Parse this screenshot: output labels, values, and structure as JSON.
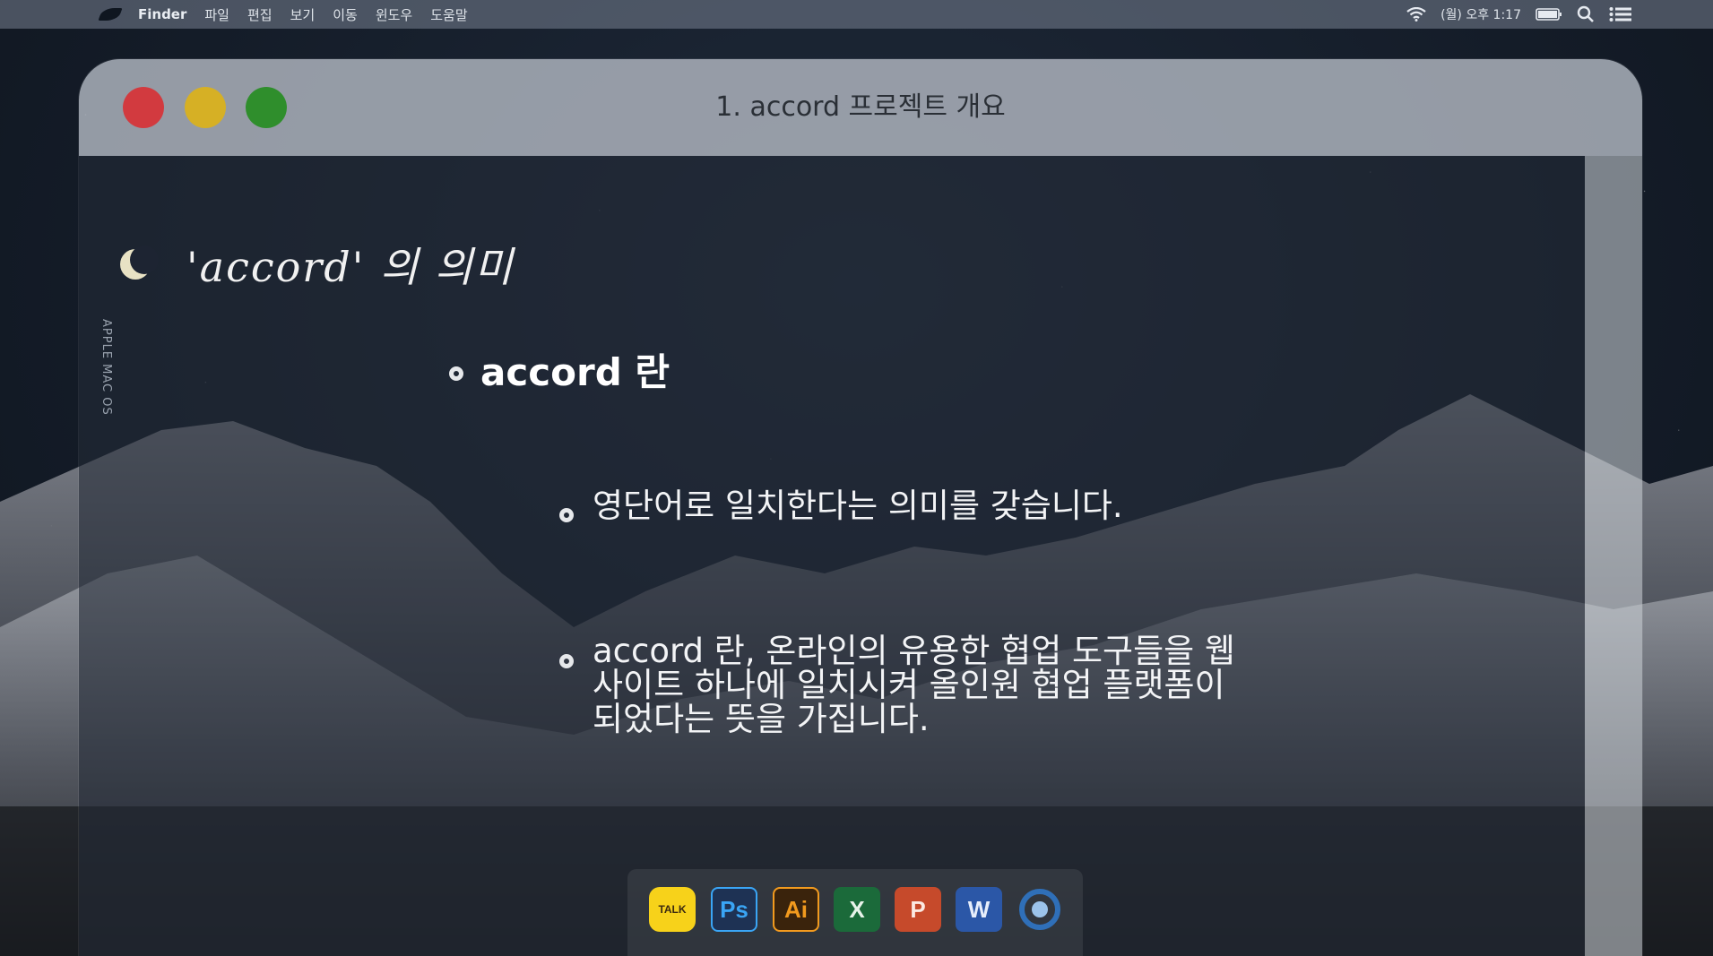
{
  "menubar": {
    "app_name": "Finder",
    "menus": [
      "파일",
      "편집",
      "보기",
      "이동",
      "윈도우",
      "도움말"
    ],
    "clock": "(월) 오후 1:17"
  },
  "window": {
    "title": "1. accord 프로젝트 개요"
  },
  "slide": {
    "section_title": "'accord' 의 의미",
    "side_label": "APPLE MAC OS",
    "heading": "accord 란",
    "paragraph_1": "영단어로 일치한다는 의미를 갖습니다.",
    "paragraph_2_line_1": "accord 란, 온라인의 유용한 협업 도구들을 웹",
    "paragraph_2_line_2": "사이트 하나에 일치시켜 올인원 협업 플랫폼이",
    "paragraph_2_line_3": "되었다는 뜻을 가집니다."
  },
  "dock": {
    "talk": "TALK",
    "ps": "Ps",
    "ai": "Ai",
    "excel": "X",
    "powerpoint": "P",
    "word": "W"
  },
  "colors": {
    "close": "#d23a3f",
    "minimize": "#d6b025",
    "maximize": "#2f8e2c"
  },
  "icons": [
    "app-logo-icon",
    "wifi-icon",
    "battery-icon",
    "search-icon",
    "list-icon",
    "moon-icon",
    "kakaotalk-icon",
    "photoshop-icon",
    "illustrator-icon",
    "excel-icon",
    "powerpoint-icon",
    "word-icon",
    "chrome-icon"
  ]
}
